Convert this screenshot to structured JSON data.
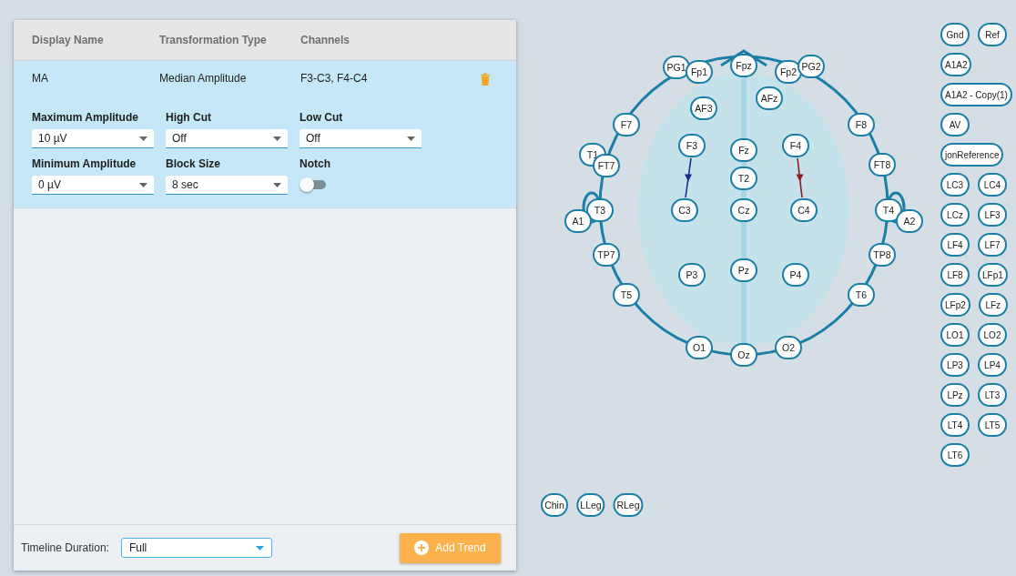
{
  "table": {
    "columns": [
      "Display Name",
      "Transformation Type",
      "Channels"
    ],
    "rows": [
      {
        "display_name": "MA",
        "transformation_type": "Median Amplitude",
        "channels": "F3-C3, F4-C4",
        "expanded": true,
        "settings": [
          {
            "kind": "select",
            "label": "Maximum Amplitude",
            "value": "10 µV"
          },
          {
            "kind": "select",
            "label": "High Cut",
            "value": "Off"
          },
          {
            "kind": "select",
            "label": "Low Cut",
            "value": "Off"
          },
          {
            "kind": "select",
            "label": "Minimum Amplitude",
            "value": "0 µV"
          },
          {
            "kind": "select",
            "label": "Block Size",
            "value": "8 sec"
          },
          {
            "kind": "toggle",
            "label": "Notch",
            "on": false
          }
        ]
      }
    ]
  },
  "footer": {
    "label": "Timeline Duration:",
    "select_value": "Full",
    "button": "Add Trend"
  },
  "head": {
    "electrodes": [
      "PG1",
      "Fp1",
      "Fpz",
      "Fp2",
      "PG2",
      "AF3",
      "AFz",
      "F7",
      "F8",
      "F3",
      "Fz",
      "F4",
      "T1",
      "FT7",
      "FT8",
      "T2",
      "T3",
      "A1",
      "C3",
      "Cz",
      "C4",
      "T4",
      "A2",
      "TP7",
      "TP8",
      "P3",
      "Pz",
      "P4",
      "T5",
      "T6",
      "O1",
      "Oz",
      "O2"
    ],
    "derivations": [
      {
        "color": "#1b2a8f"
      },
      {
        "color": "#8e1b1b"
      }
    ]
  },
  "body_electrodes": [
    "Chin",
    "LLeg",
    "RLeg"
  ],
  "reference_electrodes": [
    "Gnd",
    "Ref",
    "A1A2",
    "A1A2 - Copy(1)",
    "AV",
    "jonReference",
    "LC3",
    "LC4",
    "LCz",
    "LF3",
    "LF4",
    "LF7",
    "LF8",
    "LFp1",
    "LFp2",
    "LFz",
    "LO1",
    "LO2",
    "LP3",
    "LP4",
    "LPz",
    "LT3",
    "LT4",
    "LT5",
    "LT6"
  ]
}
